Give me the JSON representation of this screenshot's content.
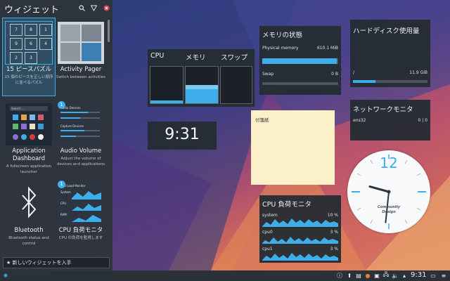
{
  "sidebar": {
    "title": "ウィジェット",
    "get_new": "新しいウィジェットを入手",
    "widgets": [
      {
        "name": "15 ピースパズル",
        "desc": "15 個のピースを正しい順序に並べるパズル"
      },
      {
        "name": "Activity Pager",
        "desc": "Switch between activities"
      },
      {
        "name": "Application Dashboard",
        "desc": "A fullscreen application launcher"
      },
      {
        "name": "Audio Volume",
        "desc": "Adjust the volume of devices and applications"
      },
      {
        "name": "Bluetooth",
        "desc": "Bluetooth status and control"
      },
      {
        "name": "CPU 負荷モニタ",
        "desc": "CPU の負荷を監視します"
      }
    ],
    "badge_count": "1",
    "puzzle_numbers": [
      "7",
      "8",
      "1",
      "9",
      "6",
      "4",
      "2",
      "3",
      ""
    ],
    "dashboard_search": "Search ...",
    "audio_labels": {
      "playback": "Audio Devices",
      "capture": "Capture Devices"
    },
    "cpu_thumb_title": "CPU Load Monitor",
    "cpu_thumb_rows": [
      "System",
      "CPU",
      "RAM"
    ]
  },
  "widgets": {
    "usage": {
      "labels": [
        "CPU",
        "メモリ",
        "スワップ"
      ],
      "levels": [
        0.08,
        0.5,
        0
      ]
    },
    "memory": {
      "title": "メモリの状態",
      "physical_label": "Physical memory",
      "physical_value": "610.1 MiB",
      "physical_level": 0.98,
      "swap_label": "Swap",
      "swap_value": "0 B",
      "swap_level": 0
    },
    "disk": {
      "title": "ハードディスク使用量",
      "mount": "/",
      "value": "11.9 GiB",
      "level": 0.3
    },
    "network": {
      "title": "ネットワークモニタ",
      "iface": "ens32",
      "value": "0 | 0"
    },
    "digital_clock": {
      "time": "9:31"
    },
    "sticky": {
      "title": "付箋紙"
    },
    "cpu_monitor": {
      "title": "CPU 負荷モニタ",
      "rows": [
        {
          "name": "system",
          "value": "10 %"
        },
        {
          "name": "cpu0",
          "value": "3 %"
        },
        {
          "name": "cpu1",
          "value": "3 %"
        }
      ]
    },
    "analog_clock": {
      "twelve": "12",
      "brand": "Community Design",
      "hour": 9,
      "minute": 31
    }
  },
  "taskbar": {
    "time": "9:31"
  },
  "colors": {
    "accent": "#3daee9",
    "panel": "#252c33",
    "sticky": "#fbf0c7"
  }
}
